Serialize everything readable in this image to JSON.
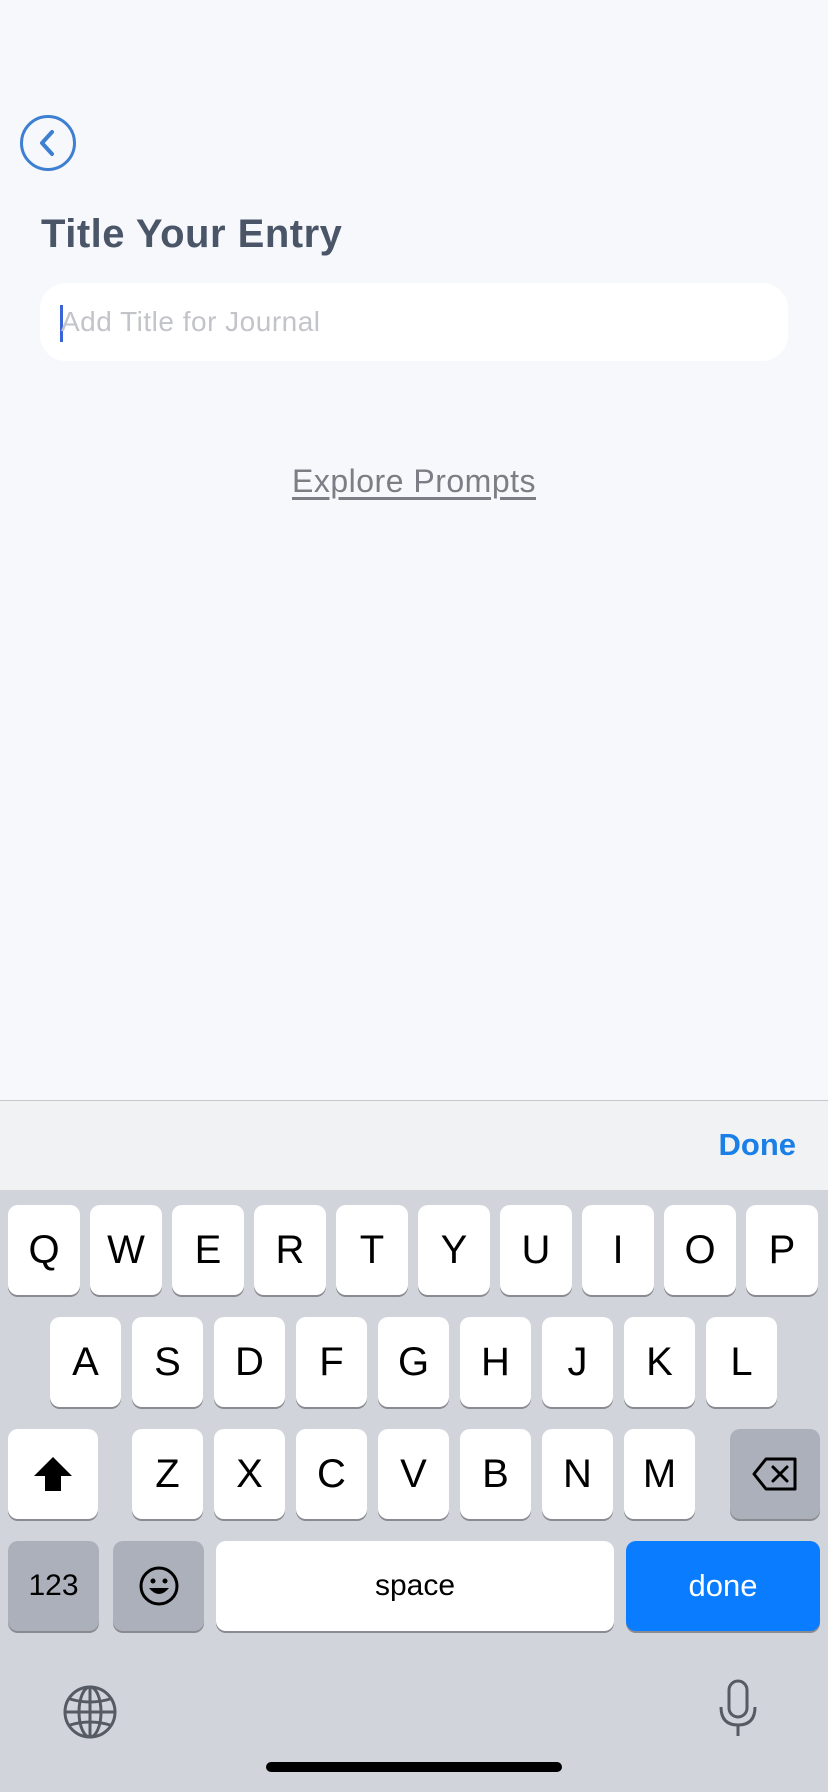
{
  "page": {
    "title": "Title Your Entry",
    "title_input": {
      "value": "",
      "placeholder": "Add Title for Journal"
    },
    "explore_prompts": "Explore Prompts"
  },
  "accessory_bar": {
    "done_label": "Done"
  },
  "keyboard": {
    "row1": [
      "Q",
      "W",
      "E",
      "R",
      "T",
      "Y",
      "U",
      "I",
      "O",
      "P"
    ],
    "row2": [
      "A",
      "S",
      "D",
      "F",
      "G",
      "H",
      "J",
      "K",
      "L"
    ],
    "row3": [
      "Z",
      "X",
      "C",
      "V",
      "B",
      "N",
      "M"
    ],
    "numbers_label": "123",
    "space_label": "space",
    "return_label": "done"
  },
  "icons": {
    "back": "chevron-left-icon",
    "shift": "shift-icon",
    "delete": "backspace-icon",
    "emoji": "emoji-icon",
    "globe": "globe-icon",
    "mic": "microphone-icon"
  },
  "colors": {
    "accent": "#3d7fd1",
    "keyboard_blue": "#0a7cff",
    "title_text": "#4a5568",
    "background": "#f7f8fb"
  }
}
